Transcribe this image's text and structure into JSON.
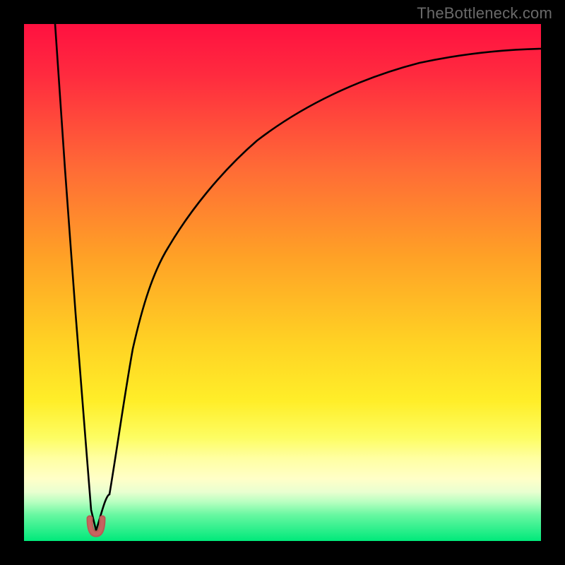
{
  "watermark": "TheBottleneck.com",
  "colors": {
    "frame": "#000000",
    "red": "#ff163d",
    "orange": "#ffa126",
    "yellow": "#ffee29",
    "paleyellow": "#ffff8a",
    "green": "#00e f7a",
    "green_solid": "#00e97b",
    "curve": "#000000",
    "marker": "#b95a54"
  },
  "chart_data": {
    "type": "line",
    "title": "",
    "xlabel": "",
    "ylabel": "",
    "xlim": [
      0,
      100
    ],
    "ylim": [
      0,
      100
    ],
    "annotations": [],
    "series": [
      {
        "name": "bottleneck-curve",
        "x": [
          6,
          8,
          10,
          12,
          13,
          14,
          15,
          16.5,
          18,
          19.5,
          21,
          23,
          25,
          28,
          32,
          38,
          45,
          55,
          68,
          82,
          100
        ],
        "y": [
          100,
          72,
          44,
          18,
          6,
          2,
          3,
          9,
          18,
          28,
          37,
          48,
          56,
          64,
          72,
          79,
          84,
          88.5,
          91.5,
          93.5,
          95
        ]
      }
    ],
    "marker": {
      "x": 14,
      "y": 2,
      "shape": "u",
      "color": "#b95a54"
    },
    "gradient_bands_pct_from_top": {
      "red_start": 0,
      "orange_mid": 45,
      "yellow_mid": 72,
      "paleyellow_start": 80,
      "paleyellow_end": 89,
      "green_start": 93,
      "green_end": 100
    }
  }
}
